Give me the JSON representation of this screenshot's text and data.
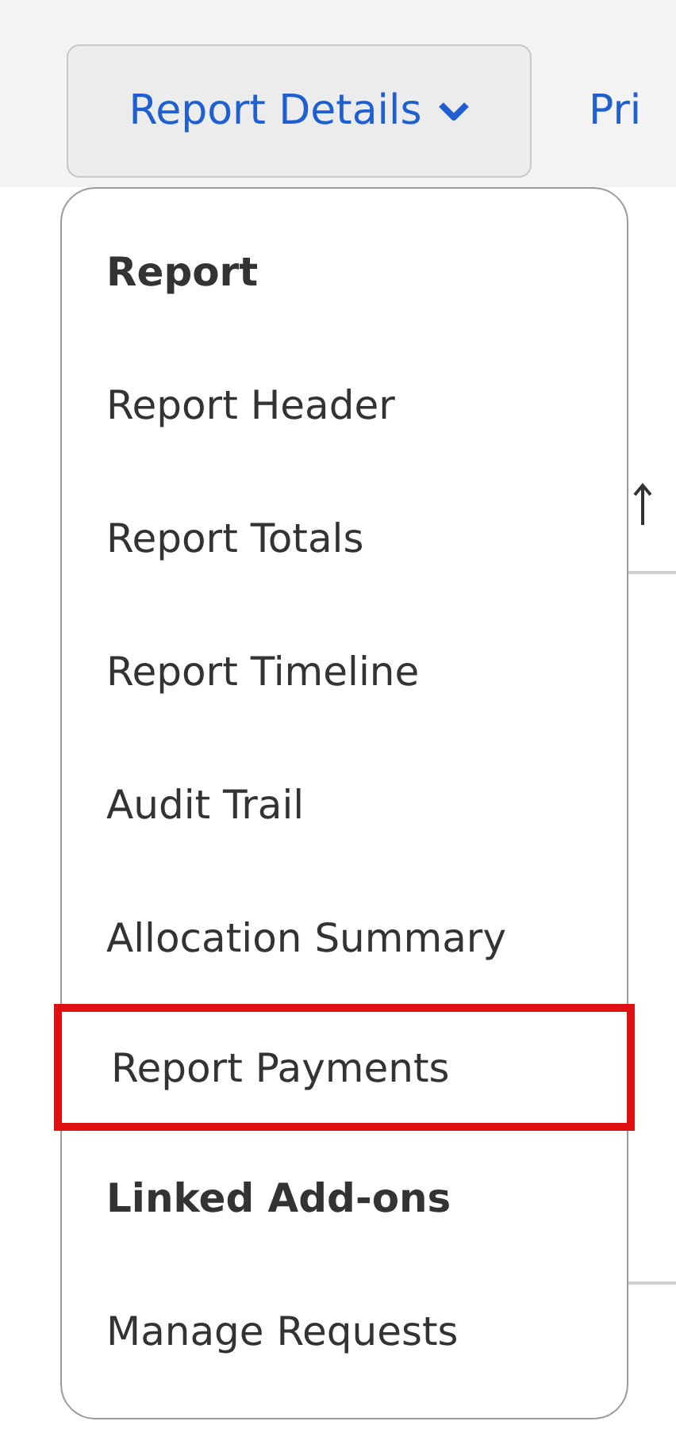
{
  "toolbar": {
    "buttons": [
      {
        "kind": "dropdown",
        "label": "Report Details"
      },
      {
        "kind": "plain",
        "label": "Pri"
      }
    ]
  },
  "menu": {
    "items": [
      {
        "kind": "header",
        "label": "Report"
      },
      {
        "kind": "item",
        "label": "Report Header",
        "highlighted": false
      },
      {
        "kind": "item",
        "label": "Report Totals",
        "highlighted": false
      },
      {
        "kind": "item",
        "label": "Report Timeline",
        "highlighted": false
      },
      {
        "kind": "item",
        "label": "Audit Trail",
        "highlighted": false
      },
      {
        "kind": "item",
        "label": "Allocation Summary",
        "highlighted": false
      },
      {
        "kind": "item",
        "label": "Report Payments",
        "highlighted": true
      },
      {
        "kind": "header",
        "label": "Linked Add-ons"
      },
      {
        "kind": "item",
        "label": "Manage Requests",
        "highlighted": false
      }
    ]
  }
}
